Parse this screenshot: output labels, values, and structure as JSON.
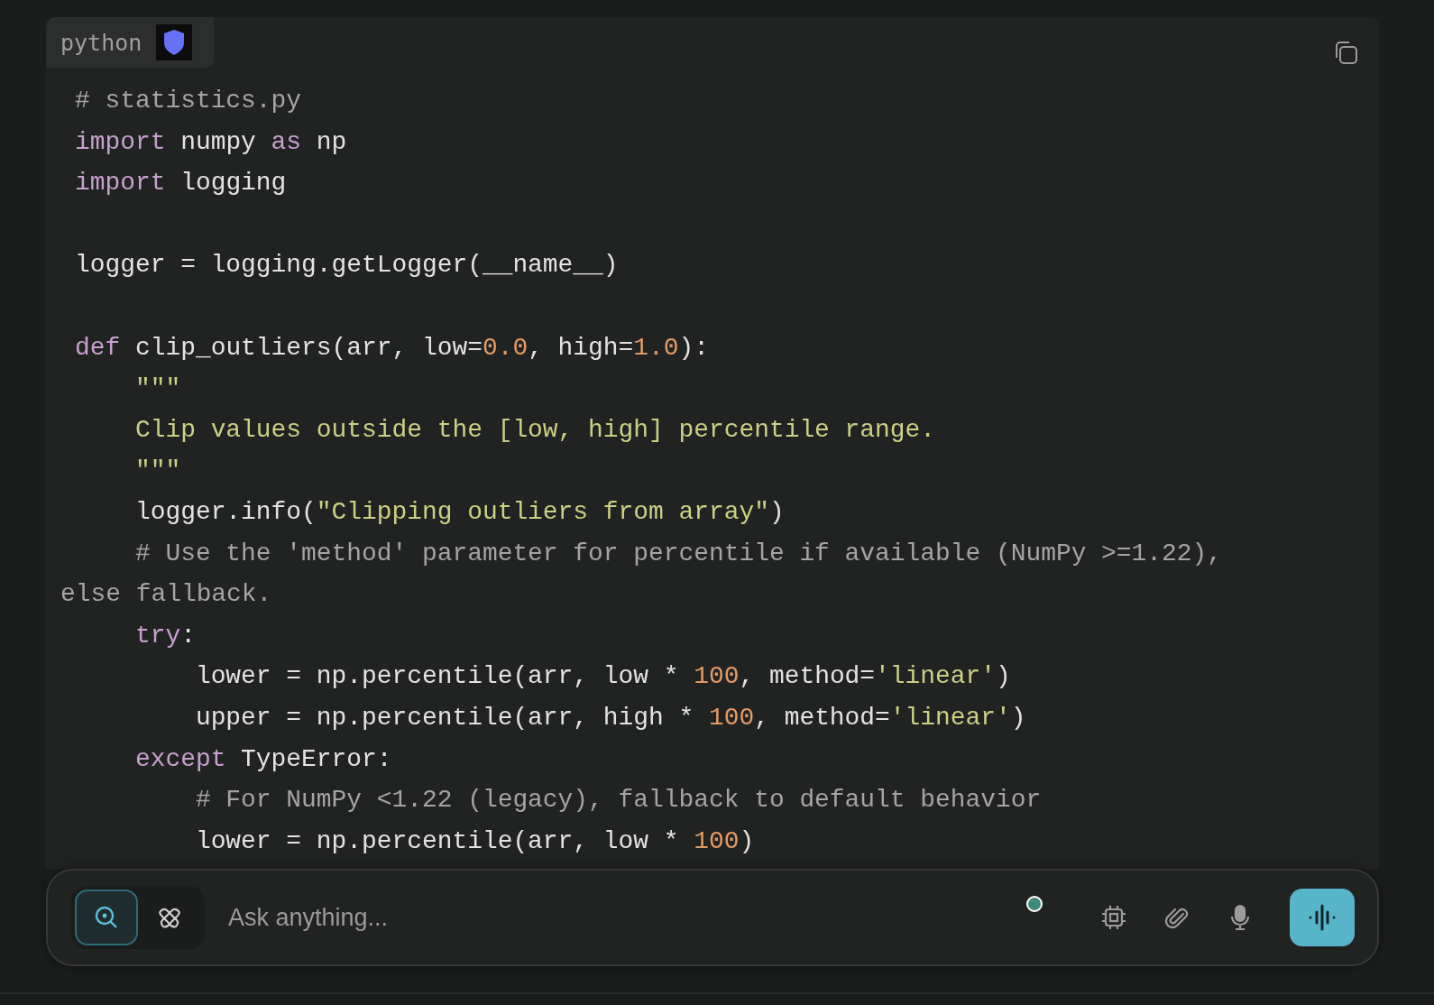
{
  "code_block": {
    "language": "python",
    "lines": [
      {
        "tokens": [
          {
            "kind": "comment",
            "text": "# statistics.py"
          }
        ]
      },
      {
        "tokens": [
          {
            "kind": "keyword",
            "text": "import"
          },
          {
            "kind": "plain",
            "text": " numpy "
          },
          {
            "kind": "keyword",
            "text": "as"
          },
          {
            "kind": "plain",
            "text": " np"
          }
        ]
      },
      {
        "tokens": [
          {
            "kind": "keyword",
            "text": "import"
          },
          {
            "kind": "plain",
            "text": " logging"
          }
        ]
      },
      {
        "blank": true
      },
      {
        "tokens": [
          {
            "kind": "plain",
            "text": "logger = logging.getLogger(__name__)"
          }
        ]
      },
      {
        "blank": true
      },
      {
        "tokens": [
          {
            "kind": "keyword",
            "text": "def"
          },
          {
            "kind": "plain",
            "text": " clip_outliers(arr, low="
          },
          {
            "kind": "number",
            "text": "0.0"
          },
          {
            "kind": "plain",
            "text": ", high="
          },
          {
            "kind": "number",
            "text": "1.0"
          },
          {
            "kind": "plain",
            "text": "):"
          }
        ]
      },
      {
        "tokens": [
          {
            "kind": "string",
            "text": "    \"\"\""
          }
        ]
      },
      {
        "tokens": [
          {
            "kind": "string",
            "text": "    Clip values outside the [low, high] percentile range."
          }
        ]
      },
      {
        "tokens": [
          {
            "kind": "string",
            "text": "    \"\"\""
          }
        ]
      },
      {
        "tokens": [
          {
            "kind": "plain",
            "text": "    logger.info("
          },
          {
            "kind": "string",
            "text": "\"Clipping outliers from array\""
          },
          {
            "kind": "plain",
            "text": ")"
          }
        ]
      },
      {
        "tokens": [
          {
            "kind": "comment",
            "text": "    # Use the 'method' parameter for percentile if available (NumPy >=1.22),"
          }
        ]
      },
      {
        "wrapped": true,
        "tokens": [
          {
            "kind": "comment",
            "text": "else fallback."
          }
        ]
      },
      {
        "tokens": [
          {
            "kind": "keyword",
            "text": "    try"
          },
          {
            "kind": "plain",
            "text": ":"
          }
        ]
      },
      {
        "tokens": [
          {
            "kind": "plain",
            "text": "        lower = np.percentile(arr, low * "
          },
          {
            "kind": "number",
            "text": "100"
          },
          {
            "kind": "plain",
            "text": ", method="
          },
          {
            "kind": "string",
            "text": "'linear'"
          },
          {
            "kind": "plain",
            "text": ")"
          }
        ]
      },
      {
        "tokens": [
          {
            "kind": "plain",
            "text": "        upper = np.percentile(arr, high * "
          },
          {
            "kind": "number",
            "text": "100"
          },
          {
            "kind": "plain",
            "text": ", method="
          },
          {
            "kind": "string",
            "text": "'linear'"
          },
          {
            "kind": "plain",
            "text": ")"
          }
        ]
      },
      {
        "tokens": [
          {
            "kind": "keyword",
            "text": "    except"
          },
          {
            "kind": "plain",
            "text": " TypeError:"
          }
        ]
      },
      {
        "tokens": [
          {
            "kind": "comment",
            "text": "        # For NumPy <1.22 (legacy), fallback to default behavior"
          }
        ]
      },
      {
        "tokens": [
          {
            "kind": "plain",
            "text": "        lower = np.percentile(arr, low * "
          },
          {
            "kind": "number",
            "text": "100"
          },
          {
            "kind": "plain",
            "text": ")"
          }
        ]
      }
    ]
  },
  "composer": {
    "modes": [
      {
        "kind": "search",
        "selected": true
      },
      {
        "kind": "deep",
        "selected": false
      }
    ],
    "placeholder": "Ask anything...",
    "status_dot": {
      "color": "#3d8a7c"
    }
  }
}
